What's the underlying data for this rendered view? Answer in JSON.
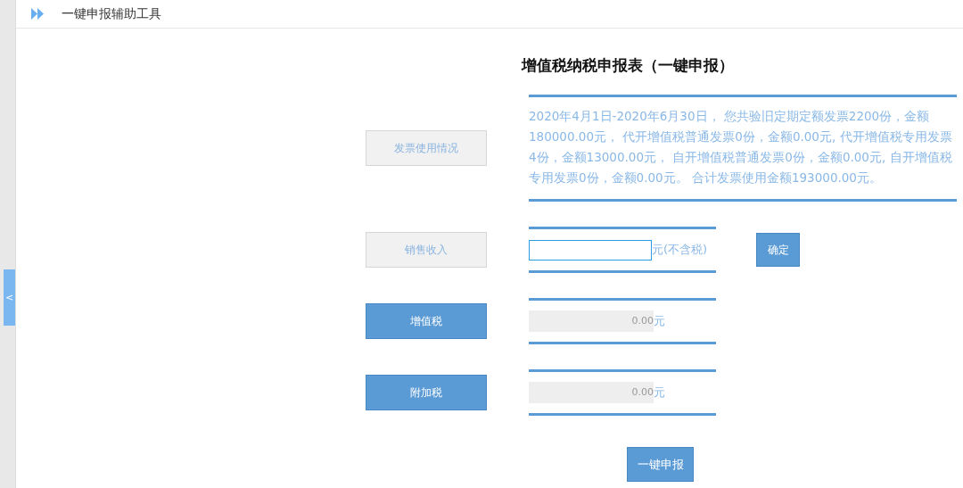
{
  "header": {
    "title": "一键申报辅助工具"
  },
  "sidebar_toggle": {
    "label": "<"
  },
  "form": {
    "title": "增值税纳税申报表（一键申报）",
    "rows": [
      {
        "kind": "info",
        "label": "发票使用情况",
        "highlighted": false,
        "text": "2020年4月1日-2020年6月30日， 您共验旧定期定额发票2200份，金额180000.00元， 代开增值税普通发票0份，金额0.00元, 代开增值税专用发票4份，金额13000.00元， 自开增值税普通发票0份，金额0.00元, 自开增值税专用发票0份，金额0.00元。 合计发票使用金额193000.00元。"
      },
      {
        "kind": "input",
        "label": "销售收入",
        "highlighted": false,
        "unit": "元(不含税)",
        "button": "确定"
      },
      {
        "kind": "readonly",
        "label": "增值税",
        "highlighted": true,
        "value": "0.00",
        "unit": "元"
      },
      {
        "kind": "readonly",
        "label": "附加税",
        "highlighted": true,
        "value": "0.00",
        "unit": "元"
      }
    ],
    "submit": "一键申报"
  }
}
